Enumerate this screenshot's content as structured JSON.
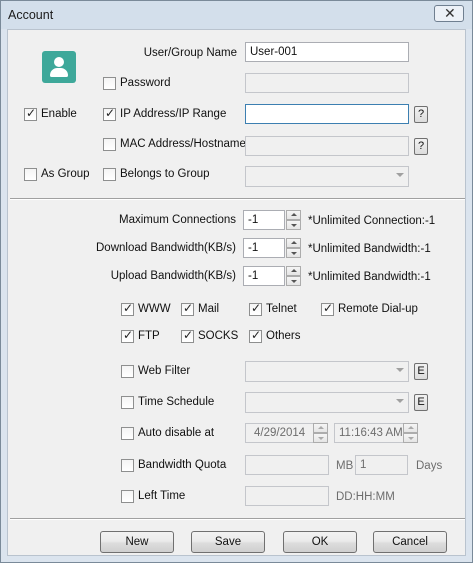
{
  "window": {
    "title": "Account"
  },
  "user": {
    "name_label": "User/Group Name",
    "name_value": "User-001",
    "password_label": "Password",
    "enable_label": "Enable",
    "ip_label": "IP Address/IP Range",
    "ip_value": "",
    "help_glyph": "?",
    "mac_label": "MAC Address/Hostname",
    "as_group_label": "As Group",
    "belongs_label": "Belongs to Group"
  },
  "limits": {
    "max_conn_label": "Maximum Connections",
    "max_conn_value": "-1",
    "max_conn_hint": "*Unlimited Connection:-1",
    "download_label": "Download Bandwidth(KB/s)",
    "download_value": "-1",
    "download_hint": "*Unlimited Bandwidth:-1",
    "upload_label": "Upload Bandwidth(KB/s)",
    "upload_value": "-1",
    "upload_hint": "*Unlimited Bandwidth:-1"
  },
  "services": [
    {
      "label": "WWW",
      "checked": true
    },
    {
      "label": "Mail",
      "checked": true
    },
    {
      "label": "Telnet",
      "checked": true
    },
    {
      "label": "Remote Dial-up",
      "checked": true
    },
    {
      "label": "FTP",
      "checked": true
    },
    {
      "label": "SOCKS",
      "checked": true
    },
    {
      "label": "Others",
      "checked": true
    }
  ],
  "options": {
    "web_filter_label": "Web Filter",
    "edit_glyph": "E",
    "time_schedule_label": "Time Schedule",
    "auto_disable_label": "Auto disable at",
    "auto_disable_date": "4/29/2014",
    "auto_disable_time": "11:16:43 AM",
    "quota_label": "Bandwidth Quota",
    "quota_unit": "MB",
    "quota_days_value": "1",
    "quota_days_unit": "Days",
    "left_time_label": "Left Time",
    "left_time_format": "DD:HH:MM"
  },
  "buttons": {
    "new": "New",
    "save": "Save",
    "ok": "OK",
    "cancel": "Cancel"
  },
  "colors": {
    "avatar": "#3ea89a",
    "title_bar": "#d3dfeb",
    "client_bg": "#f0f0f0"
  }
}
